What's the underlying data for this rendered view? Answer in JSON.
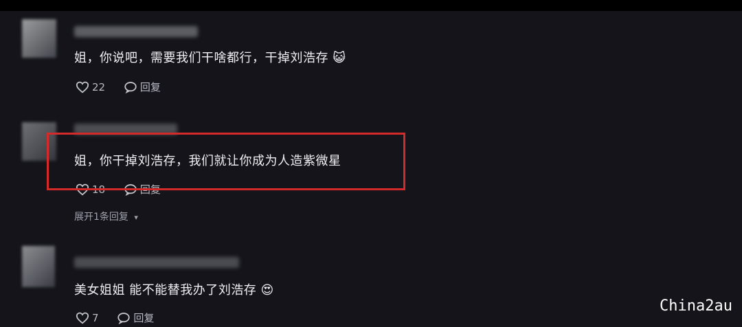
{
  "comments": [
    {
      "text": "姐，你说吧，需要我们干啥都行，干掉刘浩存",
      "emoji": "😺",
      "likes": "22",
      "reply_label": "回复"
    },
    {
      "text": "姐，你干掉刘浩存，我们就让你成为人造紫微星",
      "likes": "18",
      "reply_label": "回复",
      "expand_label": "展开1条回复",
      "highlight_color": "#d42a2a"
    },
    {
      "text": "美女姐姐 能不能替我办了刘浩存",
      "emoji": "😍",
      "likes": "7",
      "reply_label": "回复"
    }
  ],
  "watermark": "China2au",
  "colors": {
    "background": "#14141a",
    "highlight": "#d42a2a"
  }
}
